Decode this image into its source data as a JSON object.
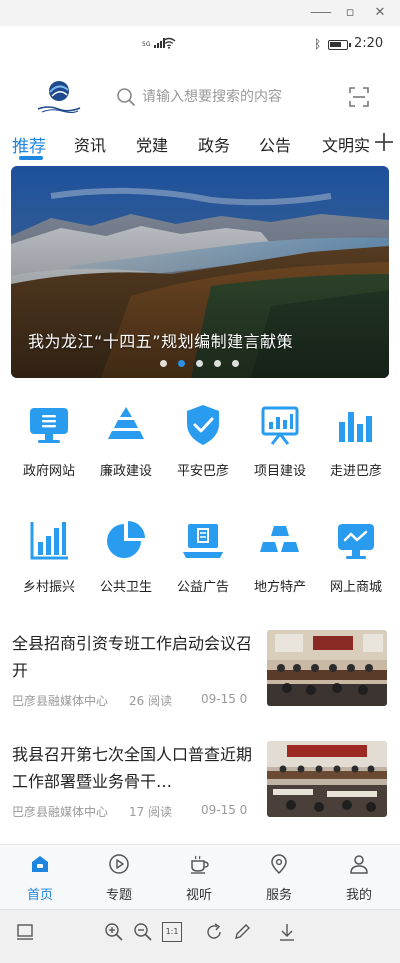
{
  "status_bar": {
    "signal_label": "5G",
    "time": "2:20",
    "battery_level": 0.75
  },
  "search": {
    "placeholder": "请输入想要搜索的内容"
  },
  "tabs": [
    {
      "label": "推荐",
      "active": true
    },
    {
      "label": "资讯"
    },
    {
      "label": "党建"
    },
    {
      "label": "政务"
    },
    {
      "label": "公告"
    },
    {
      "label": "文明实"
    }
  ],
  "banner": {
    "title": "我为龙江“十四五”规划编制建言献策",
    "slide_count": 5,
    "active_slide": 2
  },
  "services_row1": [
    {
      "label": "政府网站",
      "icon": "monitor-list-icon"
    },
    {
      "label": "廉政建设",
      "icon": "pyramid-icon"
    },
    {
      "label": "平安巴彦",
      "icon": "shield-check-icon"
    },
    {
      "label": "项目建设",
      "icon": "chart-board-icon"
    },
    {
      "label": "走进巴彦",
      "icon": "bar-chart-icon"
    }
  ],
  "services_row2": [
    {
      "label": "乡村振兴",
      "icon": "growth-chart-icon"
    },
    {
      "label": "公共卫生",
      "icon": "pie-chart-icon"
    },
    {
      "label": "公益广告",
      "icon": "laptop-icon"
    },
    {
      "label": "地方特产",
      "icon": "gold-bars-icon"
    },
    {
      "label": "网上商城",
      "icon": "online-monitor-icon"
    }
  ],
  "news": [
    {
      "title": "全县招商引资专班工作启动会议召开",
      "source": "巴彦县融媒体中心",
      "reads": "26 阅读",
      "date": "09-15 0"
    },
    {
      "title": "我县召开第七次全国人口普查近期工作部署暨业务骨干…",
      "source": "巴彦县融媒体中心",
      "reads": "17 阅读",
      "date": "09-15 0"
    }
  ],
  "bottom_nav": [
    {
      "label": "首页",
      "icon": "home-icon",
      "active": true
    },
    {
      "label": "专题",
      "icon": "play-circle-icon"
    },
    {
      "label": "视听",
      "icon": "coffee-cup-icon"
    },
    {
      "label": "服务",
      "icon": "location-pin-icon"
    },
    {
      "label": "我的",
      "icon": "user-icon"
    }
  ],
  "toolbar": {
    "fit_label": "1:1"
  },
  "colors": {
    "accent": "#1f86e0",
    "icon_blue": "#2a9cf0",
    "text": "#222222",
    "muted": "#999999"
  }
}
